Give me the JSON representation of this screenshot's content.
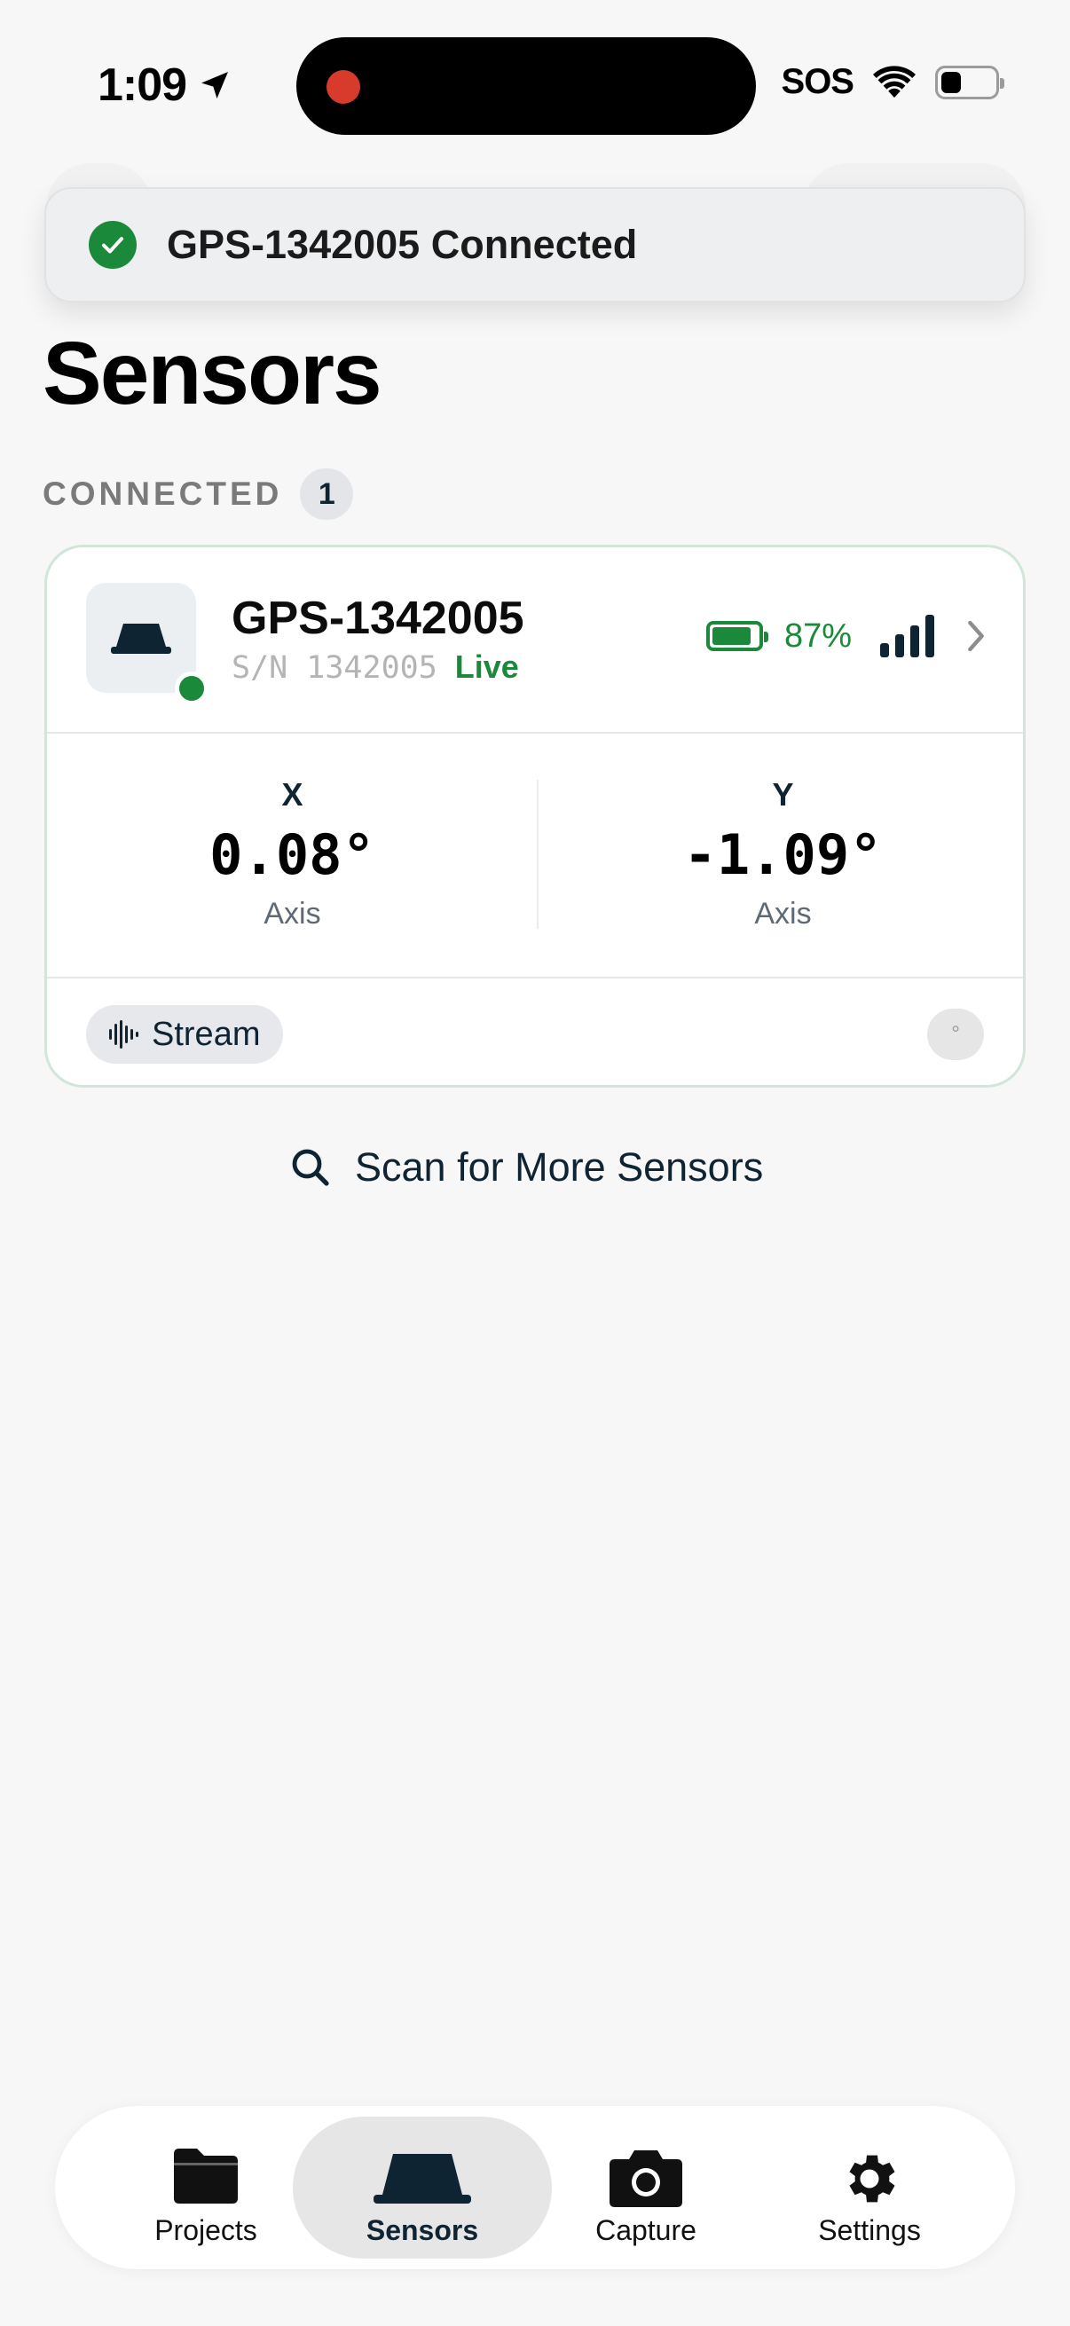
{
  "status_bar": {
    "time": "1:09",
    "carrier": "SOS",
    "recording_color": "#d83a2c"
  },
  "toast": {
    "message": "GPS-1342005 Connected"
  },
  "page_title": "Sensors",
  "section": {
    "label": "CONNECTED",
    "count": "1"
  },
  "sensor_card": {
    "name": "GPS-1342005",
    "serial": "S/N 1342005",
    "status": "Live",
    "battery": "87%",
    "battery_level": 0.87,
    "signal_bars": 4,
    "x_axis": {
      "label": "X",
      "value": "0.08°",
      "unit": "Axis"
    },
    "y_axis": {
      "label": "Y",
      "value": "-1.09°",
      "unit": "Axis"
    },
    "stream_label": "Stream",
    "degree_symbol": "°"
  },
  "scan_label": "Scan for More Sensors",
  "tabs": [
    {
      "label": "Projects",
      "icon": "folder-icon"
    },
    {
      "label": "Sensors",
      "icon": "sensor-icon"
    },
    {
      "label": "Capture",
      "icon": "camera-icon"
    },
    {
      "label": "Settings",
      "icon": "gear-icon"
    }
  ],
  "colors": {
    "accent_green": "#1a8a3a",
    "navy": "#0f2433"
  }
}
